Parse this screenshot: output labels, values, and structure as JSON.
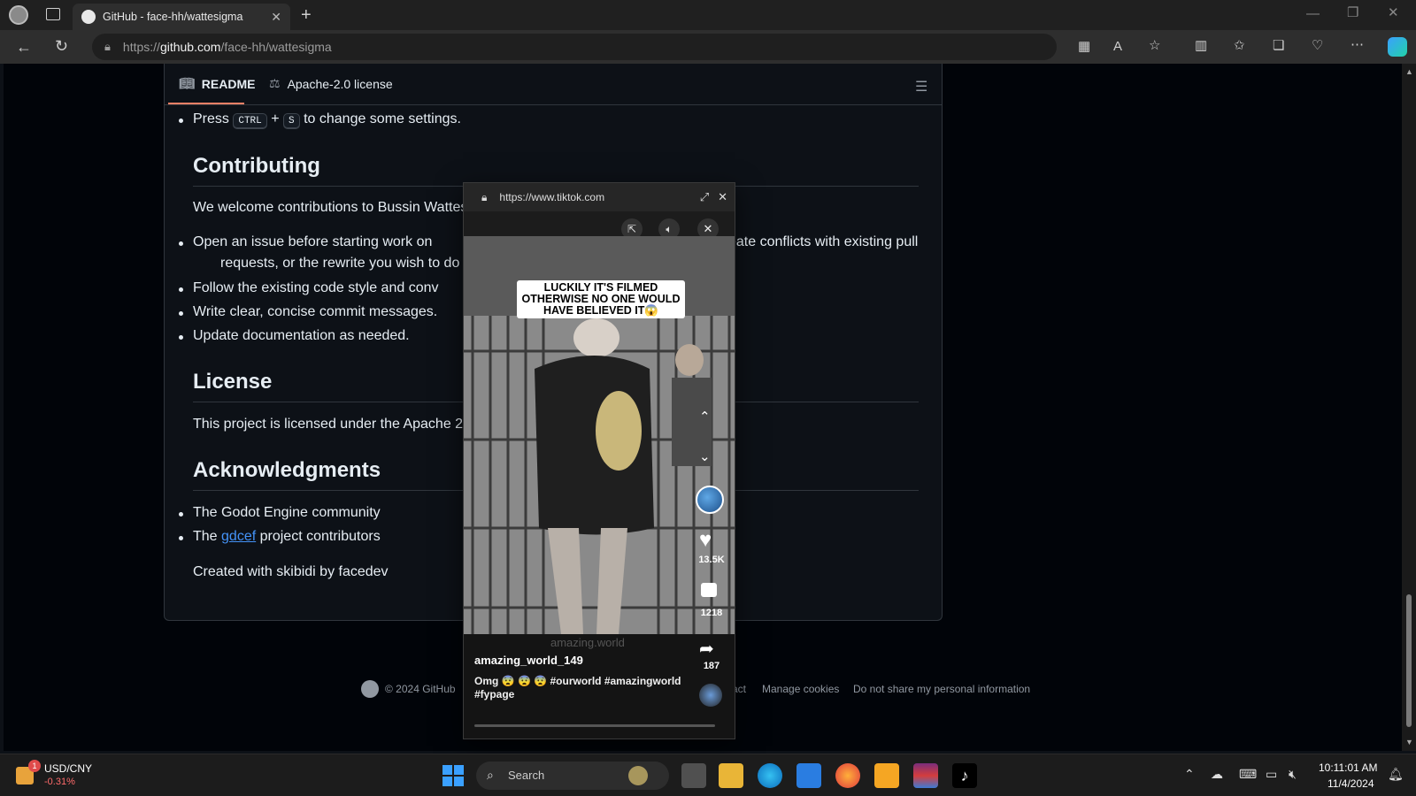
{
  "browser": {
    "tab_title": "GitHub - face-hh/wattesigma",
    "url_prefix": "https://",
    "url_host": "github.com",
    "url_path": "/face-hh/wattesigma"
  },
  "readme": {
    "tab_readme": "README",
    "tab_license": "Apache-2.0 license",
    "press": "Press",
    "kbd_ctrl": "CTRL",
    "plus": "+",
    "kbd_s": "S",
    "press_tail": "to change some settings.",
    "contributing_heading": "Contributing",
    "contributing_intro": "We welcome contributions to Bussin Wattes",
    "bullet1_a": "Open an issue before starting work on",
    "bullet1_b": "eate conflicts with existing pull",
    "bullet1_c": "requests, or the rewrite you wish to do",
    "bullet2": "Follow the existing code style and conv",
    "bullet3": "Write clear, concise commit messages.",
    "bullet4": "Update documentation as needed.",
    "license_heading": "License",
    "license_text": "This project is licensed under the Apache 2.",
    "ack_heading": "Acknowledgments",
    "ack1": "The Godot Engine community",
    "ack2_pre": "The",
    "ack2_link": "gdcef",
    "ack2_post": "project contributors",
    "created": "Created with skibidi by facedev"
  },
  "footer": {
    "copyright": "© 2024 GitHub",
    "contact": "ntact",
    "manage_cookies": "Manage cookies",
    "do_not_share": "Do not share my personal information"
  },
  "popup": {
    "url": "https://www.tiktok.com",
    "caption": "LUCKILY IT'S FILMED OTHERWISE NO ONE WOULD HAVE BELIEVED IT😱",
    "watermark": "amazing.world",
    "username": "amazing_world_149",
    "desc_line1": "Omg 😨 😨 😨 #ourworld #amazingworld",
    "desc_line2": "#fypage",
    "likes": "13.5K",
    "comments": "1218",
    "shares": "187"
  },
  "taskbar": {
    "ticker": "USD/CNY",
    "ticker_change": "-0.31%",
    "ticker_badge": "1",
    "search": "Search",
    "time": "10:11:01 AM",
    "date": "11/4/2024"
  },
  "colors": {
    "link": "#4493f8",
    "tab_underline": "#f78166",
    "ticker_change": "#ff6b6b"
  }
}
